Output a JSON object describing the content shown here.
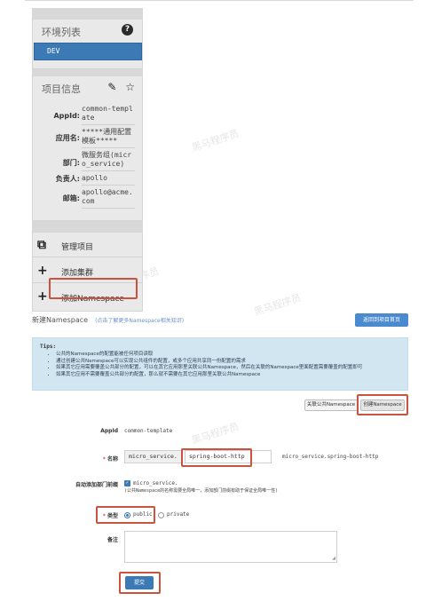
{
  "watermarks": [
    "黑马程序员",
    "黑马程序员",
    "黑马程序员",
    "黑马程序员"
  ],
  "sidebar": {
    "env_title": "环境列表",
    "help_icon": "?",
    "env_items": [
      {
        "label": "DEV"
      }
    ],
    "info_title": "项目信息",
    "info_icons": {
      "edit": "✎",
      "star": "☆"
    },
    "info": [
      {
        "label": "AppId:",
        "value": "common-template"
      },
      {
        "label": "应用名:",
        "value": "*****通用配置模板*****"
      },
      {
        "label": "部门:",
        "value": "微服务组(micro_service)"
      },
      {
        "label": "负责人:",
        "value": "apollo"
      },
      {
        "label": "邮箱:",
        "value": "apollo@acme.com"
      }
    ],
    "menu": [
      {
        "icon": "⧉",
        "label": "管理项目"
      },
      {
        "icon": "+",
        "label": "添加集群"
      },
      {
        "icon": "+",
        "label": "添加Namespace"
      }
    ]
  },
  "header": {
    "title": "新建Namespace",
    "subtitle": "(点击了解更多Namespace相关知识)",
    "back_button": "返回到项目首页"
  },
  "tips": {
    "title": "Tips:",
    "items": [
      "公共的Namespace的配置能被任何项目读取",
      "通过创建公共Namespace可以实现公共组件的配置，或多个应用共享同一份配置的需求",
      "如果其它应用需要覆盖公共部分的配置，可以在其它应用那里关联公共Namespace，然后在关联的Namespace里面配置需要覆盖的配置即可",
      "如果其它应用不需要覆盖公共部分的配置，那么就不需要在其它应用那里关联公共Namespace"
    ]
  },
  "actions": {
    "link_public": "关联公共Namespace",
    "create": "创建Namespace"
  },
  "form": {
    "appid_label": "AppId",
    "appid_value": "common-template",
    "name_label": "名称",
    "name_prefix": "micro_service.",
    "name_value": "spring-boot-http",
    "name_preview": "micro_service.spring-boot-http",
    "auto_prefix_label": "自动添加部门前缀",
    "auto_prefix_value": "micro_service.",
    "auto_prefix_hint": "(公共Namespace的名称需要全局唯一，添加部门前缀有助于保证全局唯一性)",
    "type_label": "类型",
    "type_options": [
      "public",
      "private"
    ],
    "type_selected": "public",
    "remark_label": "备注",
    "remark_value": "",
    "submit": "提交"
  },
  "colors": {
    "primary": "#3b7ab5",
    "highlight": "#c9533d",
    "tips_bg": "#d2e6f2"
  }
}
